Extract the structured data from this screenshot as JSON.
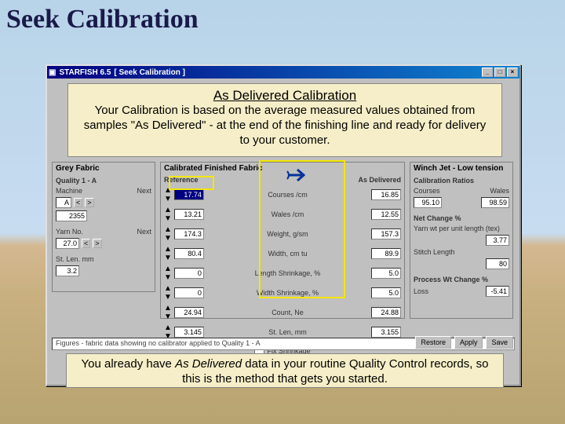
{
  "page_title": "Seek Calibration",
  "window": {
    "app": "STARFISH 6.5",
    "doc": "[ Seek Calibration ]"
  },
  "overlay_top": {
    "heading": "As Delivered Calibration",
    "body": "Your Calibration is based on the average measured values obtained from samples \"As Delivered\" - at the end of the finishing line and ready for delivery to your customer."
  },
  "overlay_bot_pre": "You already have ",
  "overlay_bot_em": "As Delivered",
  "overlay_bot_post": " data in your routine Quality Control records, so this is the method that gets you started.",
  "panels": {
    "grey": {
      "title": "Grey Fabric",
      "quality_label": "Quality 1 - A",
      "machine_lbl": "Machine",
      "next_lbl": "Next",
      "machine_val": "A",
      "machine_code": "2355",
      "yarn_lbl": "Yarn No.",
      "yarn_val": "27.0",
      "st_lbl": "St. Len. mm",
      "st_val": "3.2"
    },
    "fin": {
      "title": "Calibrated Finished Fabric",
      "col_ref": "Reference",
      "col_del": "As Delivered",
      "rows": [
        {
          "ref": "17.74",
          "label": "Courses /cm",
          "del": "16.85"
        },
        {
          "ref": "13.21",
          "label": "Wales /cm",
          "del": "12.55"
        },
        {
          "ref": "174.3",
          "label": "Weight, g/sm",
          "del": "157.3"
        },
        {
          "ref": "80.4",
          "label": "Width, cm tu",
          "del": "89.9"
        },
        {
          "ref": "0",
          "label": "Length Shrinkage, %",
          "del": "5.0"
        },
        {
          "ref": "0",
          "label": "Width Shrinkage, %",
          "del": "5.0"
        },
        {
          "ref": "24.94",
          "label": "Count, Ne",
          "del": "24.88"
        },
        {
          "ref": "3.145",
          "label": "St. Len, mm",
          "del": "3.155"
        }
      ],
      "fix_shr": "Fix Shrinkage"
    },
    "proc": {
      "title": "Winch Jet - Low tension",
      "cal_ratio_hdr": "Calibration Ratios",
      "cal_courses_lbl": "Courses",
      "cal_wales_lbl": "Wales",
      "cal_courses": "95.10",
      "cal_wales": "98.59",
      "net_hdr": "Net Change %",
      "net_yarn_lbl": "Yarn wt per unit length (tex)",
      "net_yarn": "3.77",
      "net_stitch_lbl": "Stitch Length",
      "net_stitch": "80",
      "pw_hdr": "Process Wt Change %",
      "pw_loss_lbl": "Loss",
      "pw_loss": "-5.41"
    }
  },
  "status_text": "Figures - fabric data showing no calibrator applied to Quality 1 - A",
  "buttons": {
    "restore": "Restore",
    "apply": "Apply",
    "save": "Save"
  }
}
